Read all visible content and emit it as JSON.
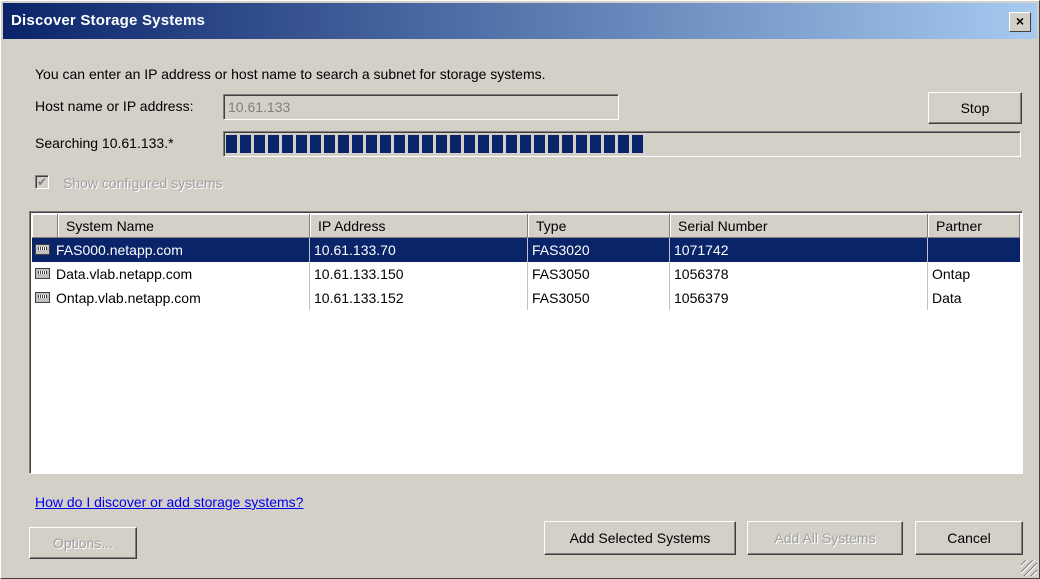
{
  "window": {
    "title": "Discover Storage Systems",
    "close_label": "×"
  },
  "instructions": "You can enter an IP address or host name to search a subnet for storage systems.",
  "host": {
    "label": "Host name or IP address:",
    "value": "10.61.133"
  },
  "stop_label": "Stop",
  "search": {
    "label": "Searching 10.61.133.*",
    "progress": 0.53
  },
  "show_configured": {
    "label": "Show configured systems",
    "checked": true
  },
  "table": {
    "columns": [
      "System Name",
      "IP Address",
      "Type",
      "Serial Number",
      "Partner"
    ],
    "rows": [
      {
        "name": "FAS000.netapp.com",
        "ip": "10.61.133.70",
        "type": "FAS3020",
        "serial": "1071742",
        "partner": "",
        "selected": true
      },
      {
        "name": "Data.vlab.netapp.com",
        "ip": "10.61.133.150",
        "type": "FAS3050",
        "serial": "1056378",
        "partner": "Ontap",
        "selected": false
      },
      {
        "name": "Ontap.vlab.netapp.com",
        "ip": "10.61.133.152",
        "type": "FAS3050",
        "serial": "1056379",
        "partner": "Data",
        "selected": false
      }
    ]
  },
  "help_link": "How do I discover or add storage systems?",
  "buttons": {
    "options": "Options...",
    "add_selected": "Add Selected Systems",
    "add_all": "Add All Systems",
    "cancel": "Cancel"
  },
  "colors": {
    "selection": "#0a246a",
    "face": "#d4d0c8",
    "link": "#0000ee"
  },
  "icons": {
    "storage_system": "storage-system-icon"
  }
}
